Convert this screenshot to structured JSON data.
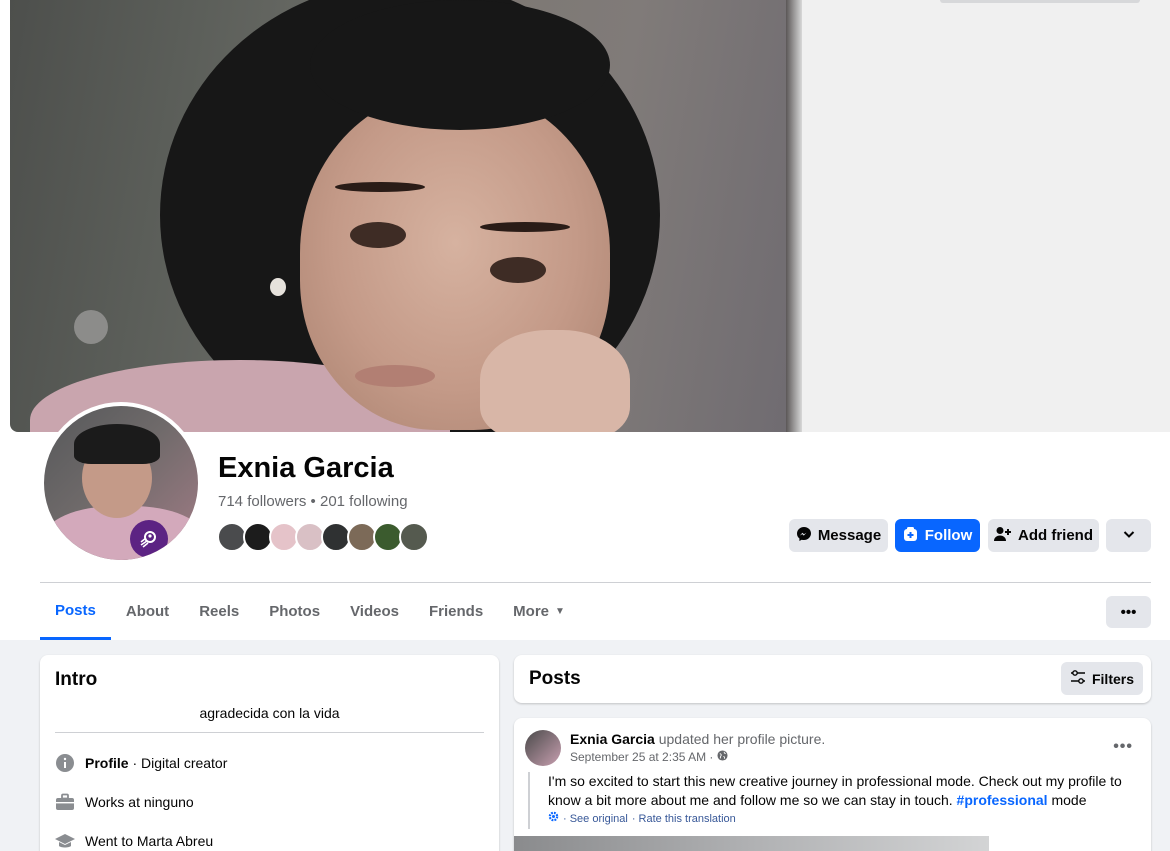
{
  "profile": {
    "name": "Exnia Garcia",
    "followers": "714 followers",
    "separator": " • ",
    "following": "201 following"
  },
  "actions": {
    "message": "Message",
    "follow": "Follow",
    "add_friend": "Add friend"
  },
  "tabs": [
    "Posts",
    "About",
    "Reels",
    "Photos",
    "Videos",
    "Friends",
    "More"
  ],
  "intro": {
    "title": "Intro",
    "bio": "agradecida con la vida",
    "profile_label": "Profile",
    "profile_value": " · Digital creator",
    "work": "Works at ninguno",
    "education": "Went to Marta Abreu"
  },
  "posts": {
    "title": "Posts",
    "filters": "Filters"
  },
  "post": {
    "author": "Exnia Garcia",
    "action": " updated her profile picture.",
    "time": "September 25 at 2:35 AM ·",
    "text_before": "I'm so excited to start this new creative journey in professional mode. Check out my profile to know a bit more about me and follow me so we can stay in touch. ",
    "hashtag": "#professional",
    "text_after": " mode",
    "see_original": "· See original",
    "rate_translation": "· Rate this translation"
  },
  "colors": {
    "accent": "#0866ff",
    "badge": "#5c2383"
  },
  "icons": {
    "message": "messenger-icon",
    "follow": "follow-plus-icon",
    "add_friend": "add-friend-icon",
    "dropdown": "chevron-down-icon",
    "more": "more-dots-icon",
    "filters": "filters-icon",
    "info": "info-icon",
    "work": "briefcase-icon",
    "education": "graduation-cap-icon",
    "privacy": "globe-icon"
  }
}
